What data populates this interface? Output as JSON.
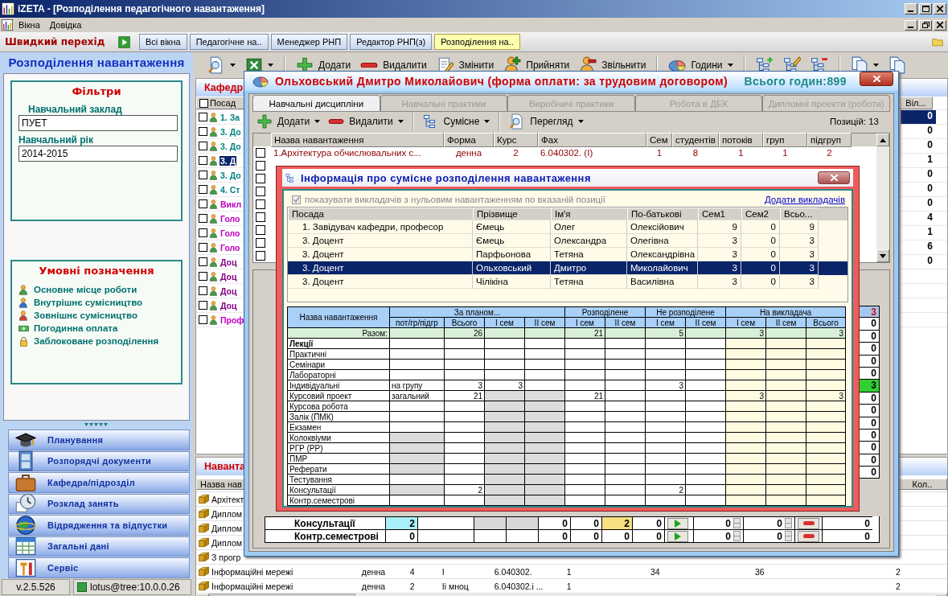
{
  "window": {
    "title": "iZETA - [Розподілення педагогічного навантаження]"
  },
  "menu": [
    "Вікна",
    "Довідка"
  ],
  "quick_nav": {
    "label": "Швидкий перехід",
    "tabs": [
      {
        "label": "Всі вікна",
        "selected": false
      },
      {
        "label": "Педагогічне на..",
        "selected": false
      },
      {
        "label": "Менеджер РНП",
        "selected": false
      },
      {
        "label": "Редактор РНП(з)",
        "selected": false
      },
      {
        "label": "Розподілення на..",
        "selected": true
      }
    ]
  },
  "left_panel": {
    "title": "Розподілення навантаження",
    "filters": {
      "title": "Фільтри",
      "fields": [
        {
          "label": "Навчальний заклад",
          "value": "ПУЕТ"
        },
        {
          "label": "Навчальний рік",
          "value": "2014-2015"
        }
      ]
    },
    "legend": {
      "title": "Умовні позначення",
      "items": [
        {
          "label": "Основне місце роботи",
          "kind": "main"
        },
        {
          "label": "Внутрішнє сумісництво",
          "kind": "internal"
        },
        {
          "label": "Зовнішнє сумісництво",
          "kind": "external"
        },
        {
          "label": "Погодинна оплата",
          "kind": "hourly"
        },
        {
          "label": "Заблоковане розподілення",
          "kind": "locked"
        }
      ]
    },
    "nav": [
      {
        "label": "Планування",
        "kind": "cap"
      },
      {
        "label": "Розпорядчі документи",
        "kind": "cabinet"
      },
      {
        "label": "Кафедра/підрозділ",
        "kind": "briefcase"
      },
      {
        "label": "Розклад занять",
        "kind": "clock"
      },
      {
        "label": "Відрядження та відпустки",
        "kind": "globe"
      },
      {
        "label": "Загальні дані",
        "kind": "table"
      },
      {
        "label": "Сервіс",
        "kind": "tools"
      }
    ]
  },
  "status_bar": {
    "version": "v.2.5.526",
    "connection": "lotus@tree:10.0.0.26"
  },
  "toolbar": [
    [
      {
        "kind": "preview",
        "dropdown": true
      },
      {
        "kind": "excel",
        "dropdown": true
      }
    ],
    [
      {
        "kind": "plus",
        "label": "Додати",
        "dropdown": false
      },
      {
        "kind": "minus",
        "label": "Видалити",
        "dropdown": false
      },
      {
        "kind": "edit",
        "label": "Змінити",
        "dropdown": false
      },
      {
        "kind": "hire",
        "label": "Прийняти",
        "dropdown": false
      },
      {
        "kind": "fire",
        "label": "Звільнити",
        "dropdown": false
      }
    ],
    [
      {
        "kind": "pie",
        "label": "Години",
        "dropdown": true
      }
    ],
    [
      {
        "kind": "tree_add",
        "dropdown": false
      },
      {
        "kind": "tree_edit",
        "dropdown": false
      },
      {
        "kind": "tree_remove",
        "dropdown": false
      }
    ],
    [
      {
        "kind": "copy",
        "dropdown": true
      },
      {
        "kind": "copy",
        "dropdown": false
      }
    ]
  ],
  "staff_panel": {
    "title": "Кафедр",
    "first_column": "Посад",
    "last_column": "Віл...",
    "rows": [
      {
        "text": "1. За",
        "color": "#008080",
        "checked": false,
        "selected": false,
        "value": "0",
        "value_selected": true
      },
      {
        "text": "3. До",
        "color": "#008080",
        "checked": false,
        "selected": false,
        "value": "0",
        "value_selected": false
      },
      {
        "text": "3. До",
        "color": "#008080",
        "checked": false,
        "selected": false,
        "value": "0",
        "value_selected": false
      },
      {
        "text": "3. Д",
        "checked": false,
        "selected": true,
        "value": "1",
        "value_selected": false
      },
      {
        "text": "3. До",
        "color": "#008080",
        "checked": false,
        "selected": false,
        "value": "0",
        "value_selected": false
      },
      {
        "text": "4. Ст",
        "color": "#008080",
        "checked": false,
        "selected": false,
        "value": "0",
        "value_selected": false
      },
      {
        "text": "Викл",
        "color": "#c000c0",
        "checked": false,
        "selected": false,
        "value": "0",
        "value_selected": false
      },
      {
        "text": "Голо",
        "color": "#c000c0",
        "checked": false,
        "selected": false,
        "value": "4",
        "value_selected": false
      },
      {
        "text": "Голо",
        "color": "#c000c0",
        "checked": false,
        "selected": false,
        "value": "1",
        "value_selected": false
      },
      {
        "text": "Голо",
        "color": "#c000c0",
        "checked": false,
        "selected": false,
        "value": "6",
        "value_selected": false
      },
      {
        "text": "Доц",
        "color": "#800080",
        "checked": false,
        "selected": false,
        "value": "0",
        "value_selected": false
      },
      {
        "text": "Доц",
        "color": "#800080",
        "checked": false,
        "selected": false
      },
      {
        "text": "Доц",
        "color": "#800080",
        "checked": false,
        "selected": false
      },
      {
        "text": "Доц",
        "color": "#800080",
        "checked": false,
        "selected": false
      },
      {
        "text": "Проф",
        "color": "#c000c0",
        "checked": false,
        "selected": false
      }
    ]
  },
  "load_panel": {
    "title": "Наванта",
    "first_column": "Назва нав",
    "last_column": "Кол..",
    "rows": [
      {
        "name": "Архітект"
      },
      {
        "name": "Диплом"
      },
      {
        "name": "Диплом"
      },
      {
        "name": "Диплом"
      },
      {
        "name": "З прогр"
      },
      {
        "name": "Інформаційні мережі",
        "form": "денна",
        "course": "4",
        "stream": "І",
        "specialty": "6.040302.",
        "semester": "1",
        "column_7": "34",
        "column_8": "36",
        "column_9": "2"
      },
      {
        "name": "Інформаційні мережі",
        "form": "денна",
        "course": "2",
        "stream": "Іі мноц",
        "specialty": "6.040302.і ...",
        "semester": "1",
        "column_9": "2"
      }
    ]
  },
  "teacher_dialog": {
    "title": "Ольховський Дмитро Миколайович (форма оплати: за трудовим договором)",
    "total": "Всього годин:899",
    "tabs": [
      {
        "label": "Навчальні дисципліни",
        "selected": true
      },
      {
        "label": "Навчальні практики",
        "selected": false
      },
      {
        "label": "Виробничі практики",
        "selected": false
      },
      {
        "label": "Робота в ДЕК",
        "selected": false
      },
      {
        "label": "Дипломні проекти (роботи)",
        "selected": false
      }
    ],
    "toolbar": [
      [
        {
          "kind": "plus",
          "label": "Додати",
          "dropdown": true
        },
        {
          "kind": "minus",
          "label": "Видалити",
          "dropdown": true
        }
      ],
      [
        {
          "kind": "tree",
          "label": "Сумісне",
          "dropdown": true
        }
      ],
      [
        {
          "kind": "preview",
          "label": "Перегляд",
          "dropdown": true
        }
      ]
    ],
    "positions": "Позицій: 13",
    "columns": [
      "Назва навантаження",
      "Форма",
      "Курс",
      "Фах",
      "Сем",
      "студентів",
      "потоків",
      "груп",
      "підгруп"
    ],
    "rows": [
      {
        "checked": false,
        "cells": [
          "1.Архітектура обчислювальних с...",
          "денна",
          "2",
          "6.040302.  (І)",
          "1",
          "8",
          "1",
          "1",
          "2"
        ]
      },
      {
        "checked": false
      },
      {
        "checked": false
      },
      {
        "checked": false
      },
      {
        "checked": false
      },
      {
        "checked": false
      },
      {
        "checked": false
      },
      {
        "checked": false
      },
      {
        "checked": false
      }
    ],
    "summary": {
      "total": "3",
      "values": [
        {
          "text": "0",
          "highlighted": false
        },
        {
          "text": "0",
          "highlighted": false
        },
        {
          "text": "0",
          "highlighted": false
        },
        {
          "text": "0",
          "highlighted": false
        },
        {
          "text": "0",
          "highlighted": false
        },
        {
          "text": "3",
          "highlighted": true
        },
        {
          "text": "0",
          "highlighted": false
        },
        {
          "text": "0",
          "highlighted": false
        },
        {
          "text": "0",
          "highlighted": false
        },
        {
          "text": "0",
          "highlighted": false
        },
        {
          "text": "0",
          "highlighted": false
        },
        {
          "text": "0",
          "highlighted": false
        },
        {
          "text": "0",
          "highlighted": false
        }
      ]
    },
    "bottom_rows": [
      {
        "name": "Консультації",
        "greyed": true,
        "plan": {
          "text": "2",
          "highlighted": true
        },
        "values": [
          {
            "text": "0",
            "highlighted": false
          },
          {
            "text": "0",
            "highlighted": false
          },
          {
            "text": "2",
            "highlighted": true
          },
          {
            "text": "0",
            "highlighted": false
          }
        ],
        "spin_1": "0",
        "spin_2": "0",
        "total": "0"
      },
      {
        "name": "Контр.семестрові",
        "greyed": false,
        "plan": {
          "text": "0",
          "highlighted": false
        },
        "values": [
          {
            "text": "0",
            "highlighted": false
          },
          {
            "text": "0",
            "highlighted": false
          },
          {
            "text": "0",
            "highlighted": false
          },
          {
            "text": "0",
            "highlighted": false
          }
        ],
        "spin_1": "0",
        "spin_2": "0",
        "total": "0"
      }
    ]
  },
  "joint_dialog": {
    "title": "Інформація про сумісне розподілення навантаження",
    "show_zero": {
      "label": "показувати викладачів з нульовим навантаженням по вказаній позиції",
      "checked": true,
      "disabled": true
    },
    "add_link": "Додати викладачів",
    "teacher_columns": [
      "Посада",
      "Прізвище",
      "Ім'я",
      "По-батькові",
      "Сем1",
      "Сем2",
      "Всьо..."
    ],
    "teachers": [
      {
        "selected": false,
        "cells": [
          "1. Завідувач кафедри, професор",
          "Ємець",
          "Олег",
          "Олексійович",
          "9",
          "0",
          "9"
        ]
      },
      {
        "selected": false,
        "cells": [
          "3. Доцент",
          "Ємець",
          "Олександра",
          "Олегівна",
          "3",
          "0",
          "3"
        ]
      },
      {
        "selected": false,
        "cells": [
          "3. Доцент",
          "Парфьонова",
          "Тетяна",
          "Олександрівна",
          "3",
          "0",
          "3"
        ]
      },
      {
        "selected": true,
        "cells": [
          "3. Доцент",
          "Ольховський",
          "Дмитро",
          "Миколайович",
          "3",
          "0",
          "3"
        ]
      },
      {
        "selected": false,
        "cells": [
          "3. Доцент",
          "Чілікіна",
          "Тетяна",
          "Василівна",
          "3",
          "0",
          "3"
        ]
      }
    ],
    "load_header": "Назва навантаження",
    "groups": [
      {
        "label": "За планом...",
        "columns": [
          {
            "kind": "pk",
            "label": "пот/гр/підгр"
          },
          {
            "kind": "pt",
            "label": "Всього"
          },
          {
            "kind": "p1",
            "label": "І сем"
          },
          {
            "kind": "p2",
            "label": "ІІ сем"
          }
        ]
      },
      {
        "label": "Розподілене",
        "columns": [
          {
            "kind": "d1",
            "label": "І сем"
          },
          {
            "kind": "d2",
            "label": "ІІ сем"
          }
        ]
      },
      {
        "label": "Не розподілене",
        "columns": [
          {
            "kind": "n1",
            "label": "І сем"
          },
          {
            "kind": "n2",
            "label": "ІІ сем"
          }
        ]
      },
      {
        "label": "На викладача",
        "columns": [
          {
            "kind": "t1",
            "label": "І сем"
          },
          {
            "kind": "t2",
            "label": "ІІ сем"
          },
          {
            "kind": "tt",
            "label": "Всього"
          }
        ]
      }
    ],
    "total_label": "Разом:",
    "total": {
      "pt": "26",
      "d1": "21",
      "n1": "5",
      "t1": "3",
      "tt": "3"
    },
    "rows": [
      {
        "name": "Лекції",
        "bold": true,
        "values": {},
        "kind": "open"
      },
      {
        "name": "Практичні",
        "bold": false,
        "values": {},
        "kind": "open"
      },
      {
        "name": "Семінари",
        "bold": false,
        "values": {},
        "kind": "open"
      },
      {
        "name": "Лабораторні",
        "bold": false,
        "values": {},
        "kind": "open"
      },
      {
        "name": "Індивідуальні",
        "bold": false,
        "values": {
          "pk": "на групу",
          "pt": "3",
          "p1": "3",
          "n1": "3"
        },
        "kind": "open"
      },
      {
        "name": "Курсовий проект",
        "bold": false,
        "values": {
          "pk": "загальний",
          "pt": "21",
          "d1": "21",
          "t1": "3",
          "tt": "3"
        },
        "kind": "semester_locked"
      },
      {
        "name": "Курсова робота",
        "bold": false,
        "values": {},
        "kind": "semester_locked"
      },
      {
        "name": "Залік (ПМК)",
        "bold": false,
        "values": {},
        "kind": "semester_locked"
      },
      {
        "name": "Екзамен",
        "bold": false,
        "values": {},
        "kind": "semester_locked"
      },
      {
        "name": "Колоквіуми",
        "bold": false,
        "values": {},
        "kind": "plan_locked"
      },
      {
        "name": "РГР (РР)",
        "bold": false,
        "values": {},
        "kind": "plan_locked"
      },
      {
        "name": "ПМР",
        "bold": false,
        "values": {},
        "kind": "plan_locked"
      },
      {
        "name": "Реферати",
        "bold": false,
        "values": {},
        "kind": "plan_locked"
      },
      {
        "name": "Тестування",
        "bold": false,
        "values": {},
        "kind": "semester_locked"
      },
      {
        "name": "Консультації",
        "bold": false,
        "values": {
          "pt": "2",
          "n1": "2"
        },
        "kind": "plan_locked"
      },
      {
        "name": "Контр.семестрові",
        "bold": false,
        "values": {},
        "kind": "semester_locked"
      }
    ]
  }
}
